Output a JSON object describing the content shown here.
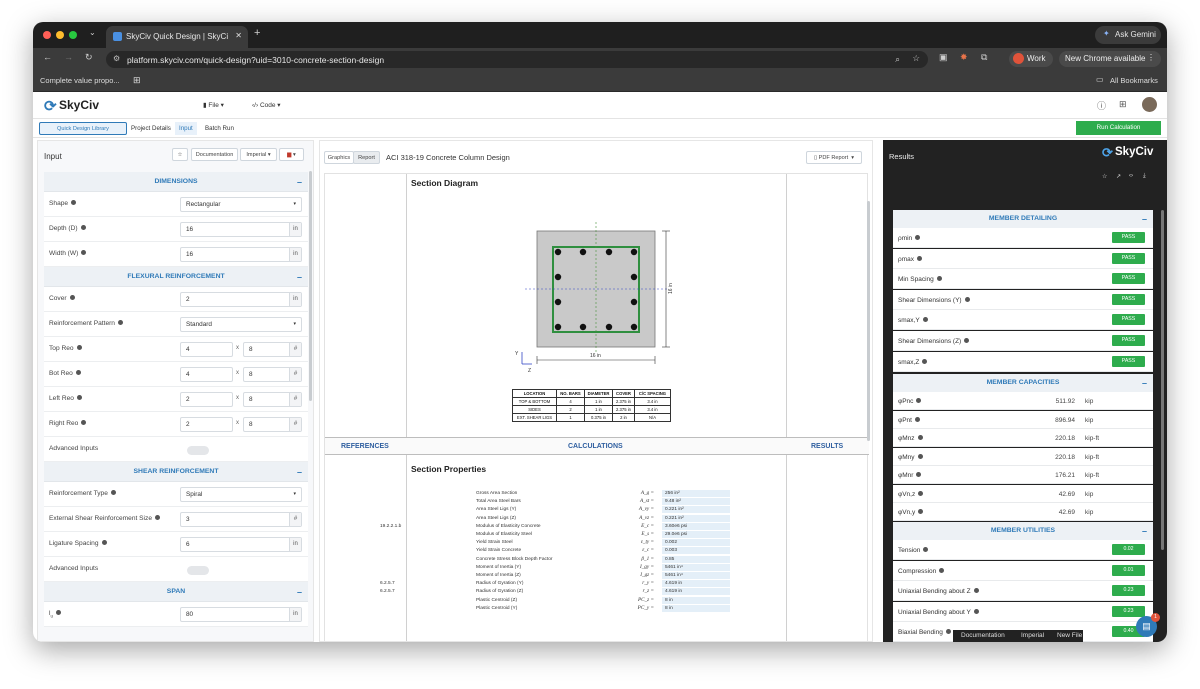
{
  "browser": {
    "tab_title": "SkyCiv Quick Design | SkyCi",
    "url": "platform.skyciv.com/quick-design?uid=3010-concrete-section-design",
    "ask_label": "Ask Gemini",
    "profile_label": "Work",
    "update_label": "New Chrome available",
    "bookmark_left": "Complete value propo...",
    "bookmarks_right": "All Bookmarks"
  },
  "header": {
    "logo": "SkyCiv",
    "menu_file": "File",
    "menu_code": "Code"
  },
  "subnav": {
    "library": "Quick Design Library",
    "project": "Project Details",
    "input": "Input",
    "batch": "Batch Run",
    "run": "Run Calculation"
  },
  "input_panel": {
    "title": "Input",
    "doc_button": "Documentation",
    "units_button": "Imperial",
    "sections": {
      "dimensions": "DIMENSIONS",
      "flexural": "FLEXURAL REINFORCEMENT",
      "shear": "SHEAR REINFORCEMENT",
      "span": "SPAN"
    },
    "rows": {
      "shape": {
        "label": "Shape",
        "value": "Rectangular"
      },
      "depth": {
        "label": "Depth (D)",
        "value": "16",
        "unit": "in"
      },
      "width": {
        "label": "Width (W)",
        "value": "16",
        "unit": "in"
      },
      "cover": {
        "label": "Cover",
        "value": "2",
        "unit": "in"
      },
      "pattern": {
        "label": "Reinforcement Pattern",
        "value": "Standard"
      },
      "top": {
        "label": "Top Reo",
        "count": "4",
        "size": "8",
        "unit": "#"
      },
      "bot": {
        "label": "Bot Reo",
        "count": "4",
        "size": "8",
        "unit": "#"
      },
      "left": {
        "label": "Left Reo",
        "count": "2",
        "size": "8",
        "unit": "#"
      },
      "right": {
        "label": "Right Reo",
        "count": "2",
        "size": "8",
        "unit": "#"
      },
      "adv1": {
        "label": "Advanced Inputs"
      },
      "rtype": {
        "label": "Reinforcement Type",
        "value": "Spiral"
      },
      "ext": {
        "label": "External Shear Reinforcement Size",
        "value": "3",
        "unit": "#"
      },
      "lig": {
        "label": "Ligature Spacing",
        "value": "6",
        "unit": "in"
      },
      "adv2": {
        "label": "Advanced Inputs"
      },
      "lu": {
        "label": "l",
        "sub": "u",
        "value": "80",
        "unit": "in"
      }
    },
    "times": "x"
  },
  "report": {
    "tab_graphics": "Graphics",
    "tab_report": "Report",
    "title": "ACI 318-19 Concrete Column Design",
    "pdf_button": "PDF Report",
    "section_diagram": "Section Diagram",
    "dim_vertical": "16 in",
    "dim_horizontal": "16 in",
    "axis_y": "Y",
    "axis_z": "Z",
    "table_headers": [
      "LOCATION",
      "NO. BARS",
      "DIAMETER",
      "COVER",
      "C/C SPACING"
    ],
    "table_rows": [
      [
        "TOP & BOTTOM",
        "4",
        "1 in",
        "2.375 in",
        "3.4 in"
      ],
      [
        "SIDES",
        "2",
        "1 in",
        "2.375 in",
        "3.4 in"
      ],
      [
        "EXT. SHEAR LIGS",
        "1",
        "0.375 in",
        "2 in",
        "N/A"
      ]
    ],
    "col_refs": "REFERENCES",
    "col_calcs": "CALCULATIONS",
    "col_results": "RESULTS",
    "section_properties": "Section Properties",
    "properties": [
      {
        "label": "Gross Area Section",
        "sym": "A_g =",
        "val": "256 in²",
        "ref": ""
      },
      {
        "label": "Total Area Steel Bars",
        "sym": "A_st =",
        "val": "9.48 in²",
        "ref": ""
      },
      {
        "label": "Area Steel Ligs (Y)",
        "sym": "A_vy =",
        "val": "0.221 in²",
        "ref": ""
      },
      {
        "label": "Area Steel Ligs (Z)",
        "sym": "A_vz =",
        "val": "0.221 in²",
        "ref": ""
      },
      {
        "label": "Modulus of Elasticity Concrete",
        "sym": "E_c =",
        "val": "3.60e6 psi",
        "ref": "19.2.2.1.b"
      },
      {
        "label": "Modulus of Elasticity Steel",
        "sym": "E_s =",
        "val": "29.0e6 psi",
        "ref": ""
      },
      {
        "label": "Yield Strain Steel",
        "sym": "ε_ty =",
        "val": "0.002",
        "ref": ""
      },
      {
        "label": "Yield Strain Concrete",
        "sym": "ε_c =",
        "val": "0.003",
        "ref": ""
      },
      {
        "label": "Concrete Stress Block Depth Factor",
        "sym": "β_1 =",
        "val": "0.85",
        "ref": ""
      },
      {
        "label": "Moment of Inertia (Y)",
        "sym": "I_gy =",
        "val": "5461 in⁴",
        "ref": ""
      },
      {
        "label": "Moment of Inertia (Z)",
        "sym": "I_gz =",
        "val": "5461 in⁴",
        "ref": ""
      },
      {
        "label": "Radius of Gyration (Y)",
        "sym": "r_y =",
        "val": "4.619 in",
        "ref": "6.2.5.7"
      },
      {
        "label": "Radius of Gyration (Z)",
        "sym": "r_z =",
        "val": "4.619 in",
        "ref": "6.2.5.7"
      },
      {
        "label": "Plastic Centroid (Z)",
        "sym": "PC_z =",
        "val": "8 in",
        "ref": ""
      },
      {
        "label": "Plastic Centroid (Y)",
        "sym": "PC_y =",
        "val": "8 in",
        "ref": ""
      }
    ]
  },
  "results": {
    "title": "Results",
    "logo": "SkyCiv",
    "member_detailing": "MEMBER DETAILING",
    "detailing": [
      {
        "label": "ρmin",
        "status": "PASS"
      },
      {
        "label": "ρmax",
        "status": "PASS"
      },
      {
        "label": "Min Spacing",
        "status": "PASS"
      },
      {
        "label": "Shear Dimensions (Y)",
        "status": "PASS"
      },
      {
        "label": "smax,Y",
        "status": "PASS"
      },
      {
        "label": "Shear Dimensions (Z)",
        "status": "PASS"
      },
      {
        "label": "smax,Z",
        "status": "PASS"
      }
    ],
    "member_capacities": "MEMBER CAPACITIES",
    "capacities": [
      {
        "label": "φPnc",
        "value": "511.92",
        "unit": "kip"
      },
      {
        "label": "φPnt",
        "value": "896.94",
        "unit": "kip"
      },
      {
        "label": "φMnz",
        "value": "220.18",
        "unit": "kip-ft"
      },
      {
        "label": "φMny",
        "value": "220.18",
        "unit": "kip-ft"
      },
      {
        "label": "φMnr",
        "value": "176.21",
        "unit": "kip-ft"
      },
      {
        "label": "φVn,z",
        "value": "42.69",
        "unit": "kip"
      },
      {
        "label": "φVn,y",
        "value": "42.69",
        "unit": "kip"
      }
    ],
    "member_utilities": "MEMBER UTILITIES",
    "utilities": [
      {
        "label": "Tension",
        "value": "0.02"
      },
      {
        "label": "Compression",
        "value": "0.01"
      },
      {
        "label": "Uniaxial Bending about Z",
        "value": "0.23"
      },
      {
        "label": "Uniaxial Bending about Y",
        "value": "0.23"
      },
      {
        "label": "Biaxial Bending",
        "value": "0.40"
      }
    ],
    "footer_doc": "Documentation",
    "footer_units": "Imperial",
    "footer_new": "New File",
    "chat_badge": "1"
  },
  "colors": {
    "accent": "#2f7ab8",
    "pass": "#2eac4d",
    "run": "#2eac4d"
  }
}
